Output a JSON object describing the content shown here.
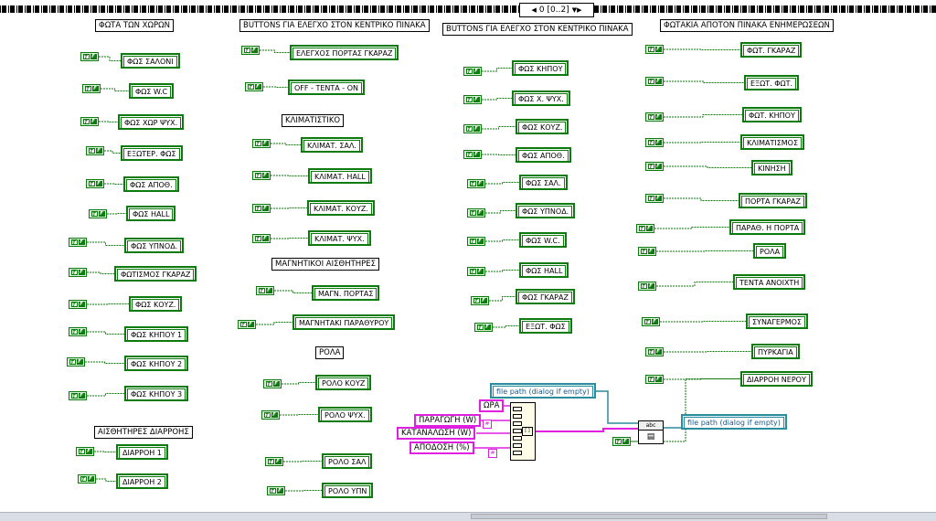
{
  "case_selector": {
    "label": "0 [0..2]"
  },
  "colors": {
    "boolean": "#0c7a0c",
    "string": "#e020e0",
    "path": "#2a8c9c"
  },
  "headers": [
    {
      "id": "h1",
      "text": "ΦΩΤΑ ΤΩΝ ΧΩΡΩΝ"
    },
    {
      "id": "h2",
      "text": "BUTTONS ΓΙΑ ΕΛΕΓΧΟ ΣΤΟΝ ΚΕΝΤΡΙΚΟ ΠΙΝΑΚΑ"
    },
    {
      "id": "h3",
      "text": "BUTTONS ΓΙΑ ΕΛΕΓΧΟ ΣΤΟΝ ΚΕΝΤΡΙΚΟ ΠΙΝΑΚΑ"
    },
    {
      "id": "h4",
      "text": "ΦΩΤΑΚΙΑ ΑΠΟΤΟΝ ΠΙΝΑΚΑ ΕΝΗΜΕΡΩΣΕΩΝ"
    },
    {
      "id": "h5",
      "text": "ΚΛΙΜΑΤΙΣΤΙΚΟ"
    },
    {
      "id": "h6",
      "text": "ΜΑΓΝΗΤΙΚΟΙ ΑΙΣΘΗΤΗΡΕΣ"
    },
    {
      "id": "h7",
      "text": "ΡΟΛΑ"
    },
    {
      "id": "h8",
      "text": "ΑΙΣΘΗΤΗΡΕΣ ΔΙΑΡΡΟΗΣ"
    }
  ],
  "indicators": [
    {
      "text": "ΦΩΣ  ΣΑΛΟΝΙ"
    },
    {
      "text": "ΦΩΣ  W.C"
    },
    {
      "text": "ΦΩΣ ΧΩΡ ΨΥΧ."
    },
    {
      "text": "ΕΞΩΤΕΡ. ΦΩΣ"
    },
    {
      "text": "ΦΩΣ ΑΠΟΘ."
    },
    {
      "text": "ΦΩΣ  HALL"
    },
    {
      "text": "ΦΩΣ ΥΠΝΟΔ."
    },
    {
      "text": "ΦΩΤΙΣΜΟΣ ΓΚΑΡΑΖ"
    },
    {
      "text": "ΦΩΣ  ΚΟΥΖ."
    },
    {
      "text": "ΦΩΣ ΚΗΠΟΥ 1"
    },
    {
      "text": "ΦΩΣ ΚΗΠΟΥ 2"
    },
    {
      "text": "ΦΩΣ ΚΗΠΟΥ 3"
    },
    {
      "text": "ΔΙΑΡΡΟΗ 1"
    },
    {
      "text": "ΔΙΑΡΡΟΗ 2"
    },
    {
      "text": "ΕΛΕΓΧΟΣ ΠΟΡΤΑΣ ΓΚΑΡΑΖ"
    },
    {
      "text": "OFF  - ΤΕΝΤΑ  - ON"
    },
    {
      "text": "ΚΛΙΜΑΤ. ΣΑΛ."
    },
    {
      "text": "ΚΛΙΜΑΤ. HALL"
    },
    {
      "text": "ΚΛΙΜΑΤ. ΚΟΥΖ."
    },
    {
      "text": "ΚΛΙΜΑΤ. ΨΥΧ."
    },
    {
      "text": "ΜΑΓΝ. ΠΟΡΤΑΣ"
    },
    {
      "text": "ΜΑΓΝΗΤΑΚΙ ΠΑΡΑΘΥΡΟΥ"
    },
    {
      "text": "ΡΟΛΟ ΚΟΥΖ"
    },
    {
      "text": "ΡΟΛΟ ΨΥΧ."
    },
    {
      "text": "ΡΟΛΟ ΣΑΛ"
    },
    {
      "text": "ΡΟΛΟ ΥΠΝ"
    },
    {
      "text": "ΦΩΣ ΚΗΠΟΥ"
    },
    {
      "text": "ΦΩΣ Χ. ΨΥΧ."
    },
    {
      "text": "ΦΩΣ ΚΟΥΖ."
    },
    {
      "text": "ΦΩΣ ΑΠΟΘ."
    },
    {
      "text": "ΦΩΣ ΣΑΛ."
    },
    {
      "text": "ΦΩΣ ΥΠΝΟΔ."
    },
    {
      "text": "ΦΩΣ W.C."
    },
    {
      "text": "ΦΩΣ HALL"
    },
    {
      "text": "ΦΩΣ ΓΚΑΡΑΖ"
    },
    {
      "text": "ΕΞΩΤ. ΦΩΣ"
    },
    {
      "text": "ΦΩΤ. ΓΚΑΡΑΖ"
    },
    {
      "text": "ΕΞΩΤ. ΦΩΤ."
    },
    {
      "text": "ΦΩΤ. ΚΗΠΟΥ"
    },
    {
      "text": "ΚΛΙΜΑΤΙΣΜΟΣ"
    },
    {
      "text": "ΚΙΝΗΣΗ"
    },
    {
      "text": "ΠΟΡΤΑ ΓΚΑΡΑΖ"
    },
    {
      "text": "ΠΑΡΑΘ. Η ΠΟΡΤΑ"
    },
    {
      "text": "ΡΟΛΑ"
    },
    {
      "text": "ΤΕΝΤΑ ΑΝΟΙΧΤΗ"
    },
    {
      "text": "ΣΥΝΑΓΕΡΜΟΣ"
    },
    {
      "text": "ΠΥΡΚΑΓΙΑ"
    },
    {
      "text": "ΔΙΑΡΡΟΗ ΝΕΡΟΥ"
    }
  ],
  "string_nodes": [
    {
      "text": "ΩΡΑ"
    },
    {
      "text": "ΠΑΡΑΓΩΓΗ (W)"
    },
    {
      "text": "ΚΑΤΑΝΑΛΩΣΗ (W)"
    },
    {
      "text": "ΑΠΟΔΟΣΗ (%)"
    }
  ],
  "path_nodes": [
    {
      "text": "file path (dialog if empty)"
    },
    {
      "text": "file path (dialog if empty)"
    }
  ],
  "write_function": {
    "label": "abc"
  }
}
